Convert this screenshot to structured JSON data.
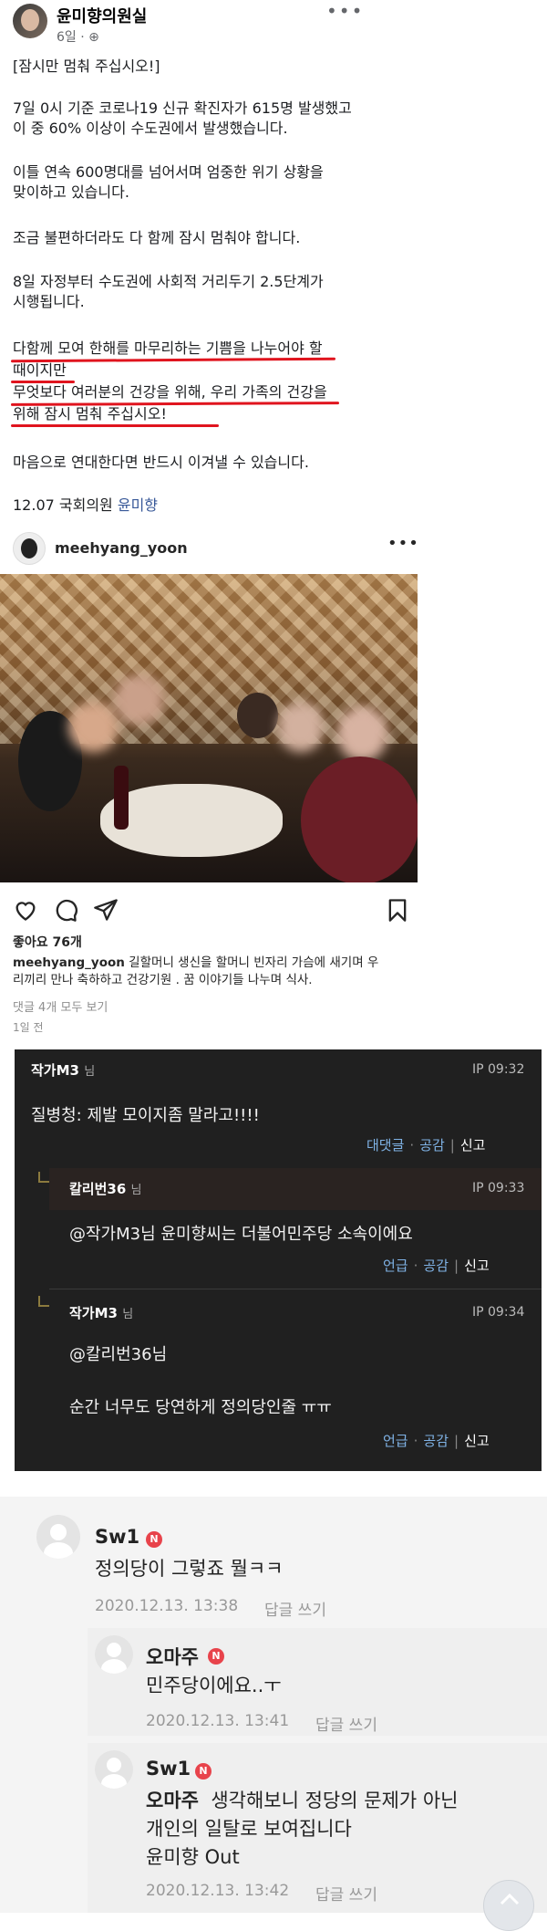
{
  "facebook": {
    "author": "윤미향의원실",
    "meta": "6일 · ",
    "paragraphs": [
      "[잠시만 멈춰 주십시오!]",
      "7일 0시 기준 코로나19 신규 확진자가 615명 발생했고\n이 중 60% 이상이 수도권에서 발생했습니다.",
      "이틀 연속 600명대를 넘어서며 엄중한 위기 상황을\n맞이하고 있습니다.",
      "조금 불편하더라도 다 함께 잠시 멈춰야 합니다.",
      "8일 자정부터 수도권에 사회적 거리두기 2.5단계가\n시행됩니다.",
      "다함께 모여 한해를 마무리하는 기쁨을 나누어야 할\n때이지만\n무엇보다 여러분의 건강을 위해, 우리 가족의 건강을\n위해 잠시 멈춰 주십시오!",
      "마음으로 연대한다면 반드시 이겨낼 수 있습니다."
    ],
    "signature_prefix": "12.07 국회의원 ",
    "signature_link": "윤미향"
  },
  "instagram": {
    "username": "meehyang_yoon",
    "likes": "좋아요 76개",
    "caption_user": "meehyang_yoon",
    "caption": " 길할머니 생신을 할머니 빈자리 가슴에 새기며 우\n리끼리 만나 축하하고 건강기원 . 꿈 이야기들 나누며 식사.",
    "view_comments": "댓글 4개 모두 보기",
    "time": "1일 전"
  },
  "dark_comments": {
    "c1": {
      "user": "작가M3",
      "suffix": "님",
      "ip": "IP 09:32",
      "text": "질병청: 제발 모이지좀 말라고!!!!",
      "reply": "대댓글",
      "like": "공감",
      "report": "신고"
    },
    "c2": {
      "user": "칼리번36",
      "suffix": "님",
      "ip": "IP 09:33",
      "mention": "@작가M3",
      "text": "님 윤미향씨는 더불어민주당 소속이에요",
      "mention_btn": "언급",
      "like": "공감",
      "report": "신고"
    },
    "c3": {
      "user": "작가M3",
      "suffix": "님",
      "ip": "IP 09:34",
      "mention": "@칼리번36",
      "mention_tail": "님",
      "text": "순간 너무도 당연하게 정의당인줄 ㅠㅠ",
      "mention_btn": "언급",
      "like": "공감",
      "report": "신고"
    }
  },
  "naver_comments": {
    "n1": {
      "name": "Sw1",
      "badge": "N",
      "text": "정의당이 그렇죠 뭘ㅋㅋ",
      "date": "2020.12.13. 13:38",
      "reply": "답글 쓰기"
    },
    "n2": {
      "name": "오마주",
      "badge": "N",
      "text": "민주당이에요..ㅜ",
      "date": "2020.12.13. 13:41",
      "reply": "답글 쓰기"
    },
    "n3": {
      "name": "Sw1",
      "badge": "N",
      "mention": "오마주",
      "text_first": "  생각해보니 정당의 문제가 아닌",
      "text_rest": "개인의 일탈로 보여집니다\n윤미향 Out",
      "date": "2020.12.13. 13:42",
      "reply": "답글 쓰기"
    }
  }
}
